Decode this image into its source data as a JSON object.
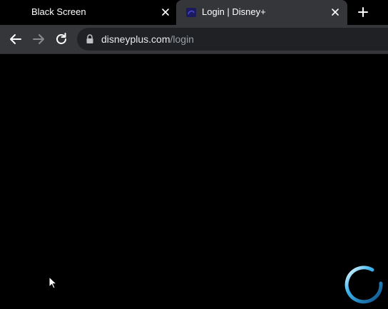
{
  "tabs": [
    {
      "title": "Black Screen",
      "active": false
    },
    {
      "title": "Login | Disney+",
      "active": true
    }
  ],
  "address_bar": {
    "host": "disneyplus.com",
    "path": "/login"
  },
  "colors": {
    "tab_strip": "#000000",
    "active_tab": "#35363a",
    "toolbar": "#35363a",
    "omnibox": "#202124",
    "page_background": "#000000",
    "spinner": "#1ea0e6"
  },
  "icons": {
    "favicon": "disney-plus-favicon",
    "close": "close-icon",
    "new_tab": "plus-icon",
    "back": "arrow-left-icon",
    "forward": "arrow-right-icon",
    "reload": "reload-icon",
    "lock": "lock-icon",
    "cursor": "mouse-pointer-icon",
    "loading": "loading-spinner-icon"
  }
}
